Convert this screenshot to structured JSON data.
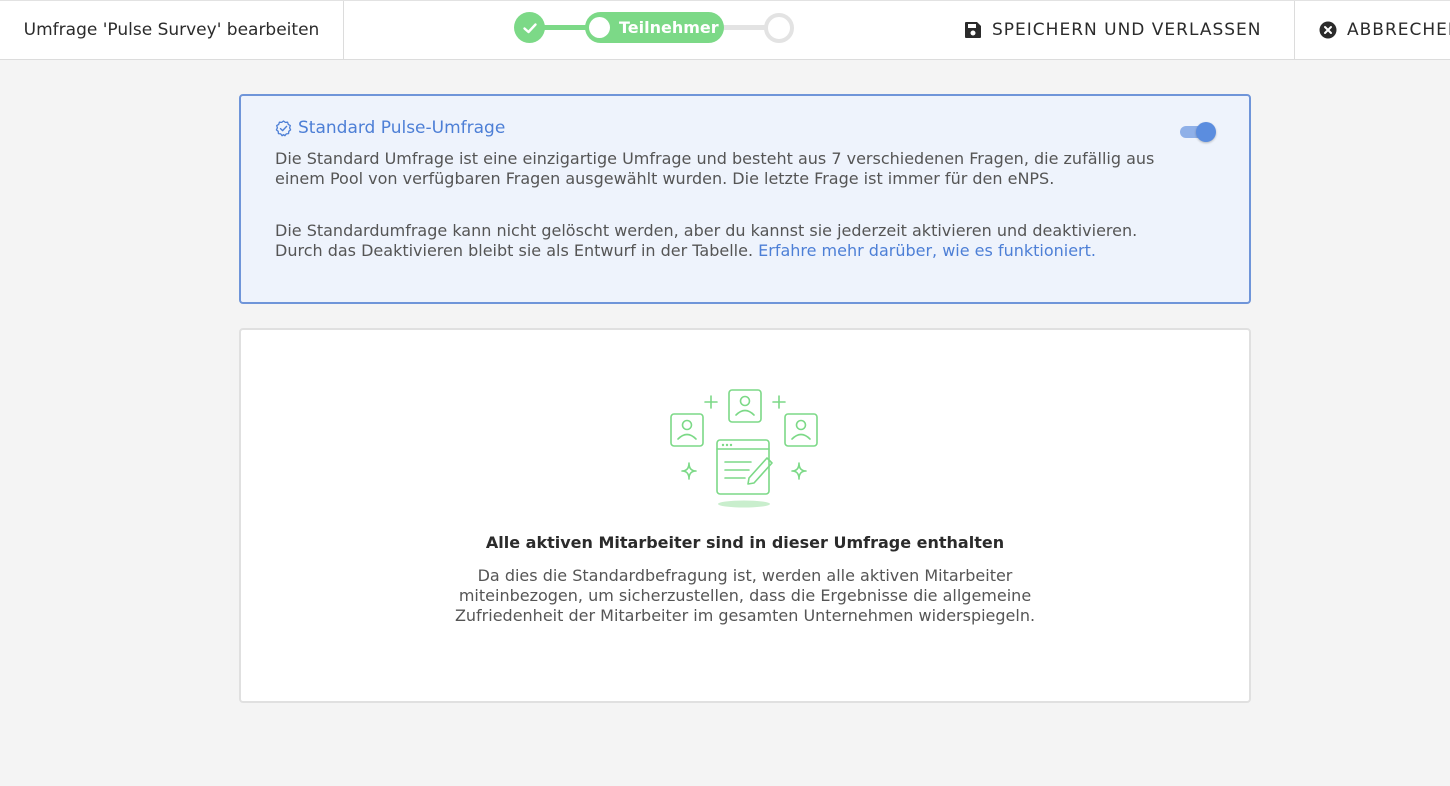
{
  "header": {
    "title": "Umfrage 'Pulse Survey' bearbeiten",
    "steps": {
      "active_label": "Teilnehmer"
    },
    "save_label": "SPEICHERN UND VERLASSEN",
    "cancel_label": "ABBRECHEN"
  },
  "info": {
    "heading": "Standard Pulse-Umfrage",
    "paragraph1": "Die Standard Umfrage ist eine einzigartige Umfrage und besteht aus 7 verschiedenen Fragen, die zufällig aus einem Pool von verfügbaren Fragen ausgewählt wurden. Die letzte Frage ist immer für den eNPS.",
    "paragraph2": "Die Standardumfrage kann nicht gelöscht werden, aber du kannst sie jederzeit aktivieren und deaktivieren. Durch das Deaktivieren bleibt sie als Entwurf in der Tabelle.",
    "link": "Erfahre mehr darüber, wie es funktioniert.",
    "toggle_on": true
  },
  "main": {
    "title": "Alle aktiven Mitarbeiter sind in dieser Umfrage enthalten",
    "description": "Da dies die Standardbefragung ist, werden alle aktiven Mitarbeiter miteinbezogen, um sicherzustellen, dass die Ergebnisse die allgemeine Zufriedenheit der Mitarbeiter im gesamten Unternehmen widerspiegeln."
  },
  "colors": {
    "accent_green": "#7cd987",
    "accent_blue": "#4d7fd6",
    "info_border": "#6f95d9",
    "info_bg": "#eef3fc"
  }
}
